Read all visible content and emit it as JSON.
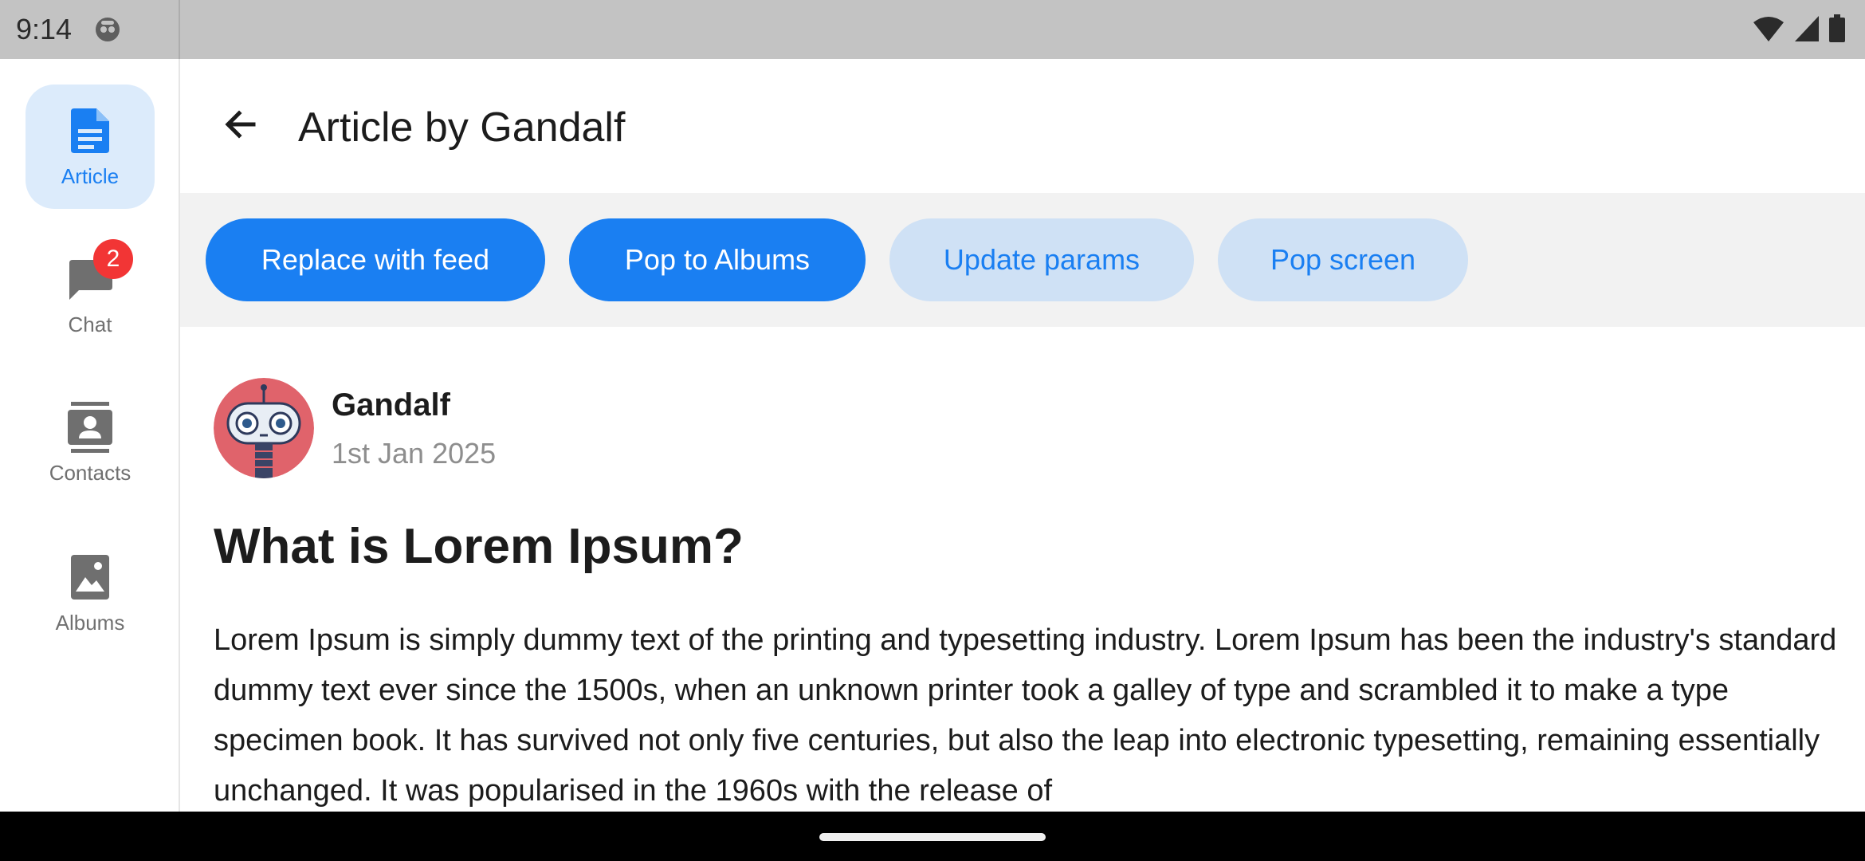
{
  "status_bar": {
    "time": "9:14",
    "icons": [
      "app-notification-icon",
      "wifi-icon",
      "cellular-signal-icon",
      "battery-icon"
    ]
  },
  "rail": {
    "items": [
      {
        "label": "Article",
        "icon": "article-icon",
        "active": true
      },
      {
        "label": "Chat",
        "icon": "chat-icon",
        "badge": "2",
        "active": false
      },
      {
        "label": "Contacts",
        "icon": "contacts-icon",
        "active": false
      },
      {
        "label": "Albums",
        "icon": "albums-icon",
        "active": false
      }
    ]
  },
  "header": {
    "title": "Article by Gandalf",
    "back_icon": "back-arrow-icon"
  },
  "actions": {
    "buttons": [
      {
        "label": "Replace with feed",
        "style": "primary"
      },
      {
        "label": "Pop to Albums",
        "style": "primary"
      },
      {
        "label": "Update params",
        "style": "secondary"
      },
      {
        "label": "Pop screen",
        "style": "secondary"
      }
    ]
  },
  "article": {
    "author": "Gandalf",
    "date": "1st Jan 2025",
    "avatar_icon": "robot-avatar-icon",
    "title": "What is Lorem Ipsum?",
    "body": "Lorem Ipsum is simply dummy text of the printing and typesetting industry. Lorem Ipsum has been the industry's standard dummy text ever since the 1500s, when an unknown printer took a galley of type and scrambled it to make a type specimen book. It has survived not only five centuries, but also the leap into electronic typesetting, remaining essentially unchanged. It was popularised in the 1960s with the release of"
  },
  "colors": {
    "accent": "#1a7ff2",
    "accent_light": "#cfe1f5",
    "rail_active": "#dcebfb",
    "badge": "#f23535",
    "avatar_bg": "#e0636b",
    "status_bar": "#c3c3c3",
    "action_bar": "#f2f2f2"
  }
}
